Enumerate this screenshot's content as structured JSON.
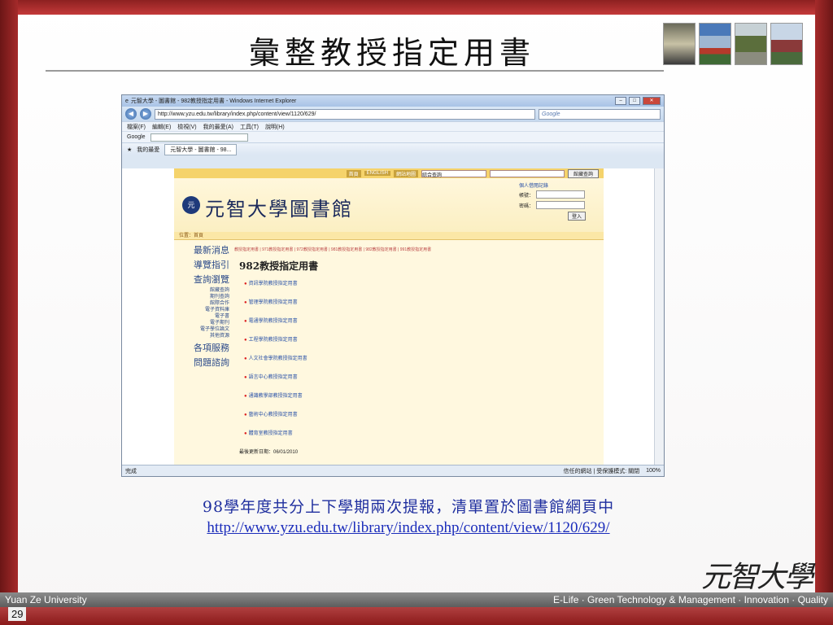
{
  "slide": {
    "title": "彙整教授指定用書",
    "caption_line1": "98學年度共分上下學期兩次提報，清單置於圖書館網頁中",
    "caption_link": "http://www.yzu.edu.tw/library/index.php/content/view/1120/629/",
    "brand": "元智大學",
    "footer_left": "Yuan Ze University",
    "footer_right": "E-Life · Green Technology & Management · Innovation · Quality",
    "page_number": "29"
  },
  "browser": {
    "window_title": "元智大學 - 圖書館 - 982教授指定用書 - Windows Internet Explorer",
    "address": "http://www.yzu.edu.tw/library/index.php/content/view/1120/629/",
    "search_placeholder": "Google",
    "menu": [
      "檔案(F)",
      "編輯(E)",
      "檢視(V)",
      "我的最愛(A)",
      "工具(T)",
      "說明(H)"
    ],
    "google_label": "Google",
    "fav_label": "我的最愛",
    "tab_label": "元智大學 - 圖書館 - 98...",
    "status_left": "完成",
    "status_zone": "信任的網站 | 受保護模式: 關閉",
    "zoom": "100%"
  },
  "site": {
    "top_links": [
      "首頁",
      "ENGLISH",
      "網站地圖"
    ],
    "select_value": "綜合查詢",
    "search_button": "館藏查詢",
    "library_name": "元智大學圖書館",
    "login_title": "個人借閱記錄",
    "login_account_label": "帳號：",
    "login_password_label": "密碼：",
    "login_button": "登入",
    "breadcrumb": "位置：首頁",
    "side_big": [
      "最新消息",
      "導覽指引",
      "查詢瀏覽"
    ],
    "side_small": [
      "館藏查詢",
      "期刊查詢",
      "館際合作",
      "電子資料庫",
      "電子書",
      "電子期刊",
      "電子學位論文",
      "其他資源"
    ],
    "side_big2": [
      "各項服務",
      "問題諮詢"
    ],
    "tabs_line": "教授指定用書 | 971教授指定用書 | 972教授指定用書 | 981教授指定用書 | 982教授指定用書 | 991教授指定用書",
    "page_heading_num": "982",
    "page_heading_text": "教授指定用書",
    "courses": [
      "資訊學院教授指定用書",
      "管理學院教授指定用書",
      "電通學院教授指定用書",
      "工程學院教授指定用書",
      "人文社會學院教授指定用書",
      "語言中心教授指定用書",
      "通識教學部教授指定用書",
      "藝術中心教授指定用書",
      "體育室教授指定用書"
    ],
    "updated": "最後更新日期：06/01/2010"
  }
}
